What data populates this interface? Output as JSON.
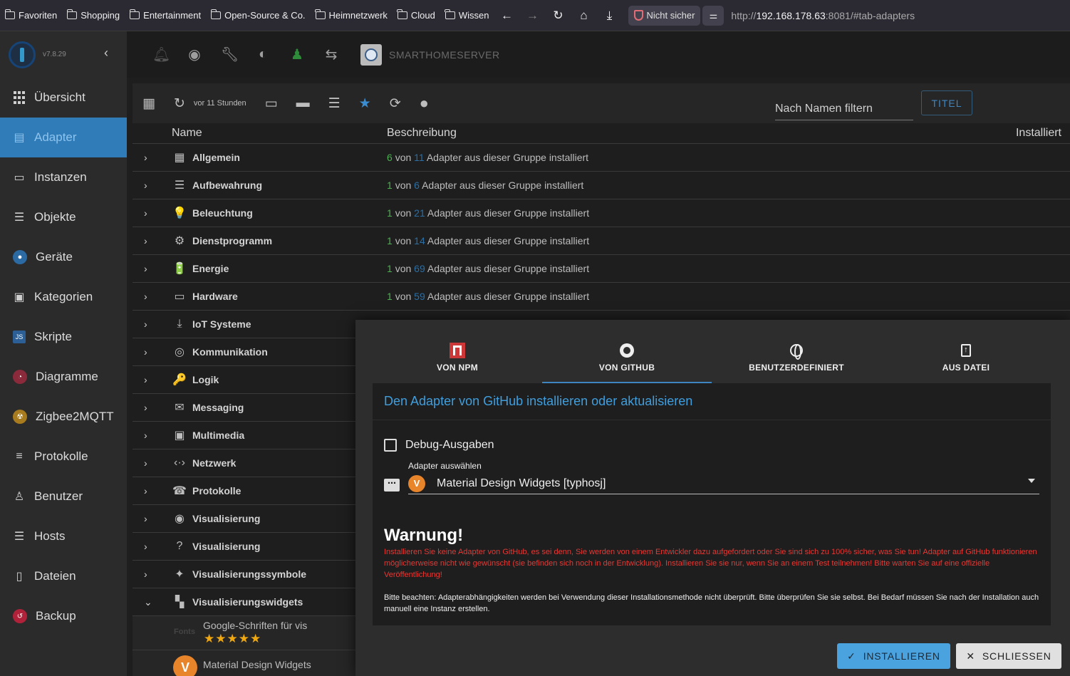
{
  "browser": {
    "bookmarks": [
      "Favoriten",
      "Shopping",
      "Entertainment",
      "Open-Source & Co.",
      "Heimnetzwerk",
      "Cloud",
      "Wissen"
    ],
    "security_label": "Nicht sicher",
    "url_prefix": "http://",
    "url_host": "192.168.178.63",
    "url_rest": ":8081/#tab-adapters"
  },
  "sidebar": {
    "version": "v7.8.29",
    "items": [
      {
        "label": "Übersicht",
        "icon": "grid-icon"
      },
      {
        "label": "Adapter",
        "icon": "store-icon",
        "active": true
      },
      {
        "label": "Instanzen",
        "icon": "instances-icon"
      },
      {
        "label": "Objekte",
        "icon": "list-icon"
      },
      {
        "label": "Geräte",
        "icon": "devices-icon"
      },
      {
        "label": "Kategorien",
        "icon": "categories-icon"
      },
      {
        "label": "Skripte",
        "icon": "js-icon"
      },
      {
        "label": "Diagramme",
        "icon": "chart-icon"
      },
      {
        "label": "Zigbee2MQTT",
        "icon": "zigbee-icon"
      },
      {
        "label": "Protokolle",
        "icon": "log-icon"
      },
      {
        "label": "Benutzer",
        "icon": "user-icon"
      },
      {
        "label": "Hosts",
        "icon": "hosts-icon"
      },
      {
        "label": "Dateien",
        "icon": "file-icon"
      },
      {
        "label": "Backup",
        "icon": "backup-icon"
      }
    ]
  },
  "topbar": {
    "server_name": "SMARTHOMESERVER"
  },
  "adapters": {
    "updated": "vor 11 Stunden",
    "filter_placeholder": "Nach Namen filtern",
    "titel_button": "TITEL",
    "col_name": "Name",
    "col_desc": "Beschreibung",
    "col_installed": "Installiert",
    "desc_von": "von",
    "desc_suffix": "Adapter aus dieser Gruppe installiert",
    "groups": [
      {
        "name": "Allgemein",
        "installed": "6",
        "total": "11",
        "icon": "▦"
      },
      {
        "name": "Aufbewahrung",
        "installed": "1",
        "total": "6",
        "icon": "☰"
      },
      {
        "name": "Beleuchtung",
        "installed": "1",
        "total": "21",
        "icon": "💡"
      },
      {
        "name": "Dienstprogramm",
        "installed": "1",
        "total": "14",
        "icon": "⚙"
      },
      {
        "name": "Energie",
        "installed": "1",
        "total": "69",
        "icon": "🔋"
      },
      {
        "name": "Hardware",
        "installed": "1",
        "total": "59",
        "icon": "▭"
      },
      {
        "name": "IoT Systeme",
        "icon": "⤓"
      },
      {
        "name": "Kommunikation",
        "icon": "◎"
      },
      {
        "name": "Logik",
        "icon": "🔑"
      },
      {
        "name": "Messaging",
        "icon": "✉"
      },
      {
        "name": "Multimedia",
        "icon": "▣"
      },
      {
        "name": "Netzwerk",
        "icon": "‹·›"
      },
      {
        "name": "Protokolle",
        "icon": "☎"
      },
      {
        "name": "Visualisierung",
        "icon": "◉"
      },
      {
        "name": "Visualisierung",
        "icon": "?"
      },
      {
        "name": "Visualisierungssymbole",
        "icon": "✦"
      },
      {
        "name": "Visualisierungswidgets",
        "icon": "▚",
        "expanded": true
      }
    ],
    "sub_items": [
      {
        "name": "Google-Schriften für vis",
        "stars": "★★★★★"
      },
      {
        "name": "Material Design Widgets"
      }
    ]
  },
  "dialog": {
    "tabs": [
      {
        "label": "VON NPM",
        "icon": "npm-icon"
      },
      {
        "label": "VON GITHUB",
        "icon": "github-icon",
        "active": true
      },
      {
        "label": "BENUTZERDEFINIERT",
        "icon": "globe-icon"
      },
      {
        "label": "AUS DATEI",
        "icon": "file-upload-icon"
      }
    ],
    "title": "Den Adapter von GitHub installieren oder aktualisieren",
    "debug_label": "Debug-Ausgaben",
    "select_label": "Adapter auswählen",
    "selected_adapter": "Material Design Widgets [typhosj]",
    "warning_title": "Warnung!",
    "warning_text": "Installieren Sie keine Adapter von GitHub, es sei denn, Sie werden von einem Entwickler dazu aufgefordert oder Sie sind sich zu 100% sicher, was Sie tun! Adapter auf GitHub funktionieren möglicherweise nicht wie gewünscht (sie befinden sich noch in der Entwicklung). Installieren Sie sie nur, wenn Sie an einem Test teilnehmen! Bitte warten Sie auf eine offizielle Veröffentlichung!",
    "note_text": "Bitte beachten: Adapterabhängigkeiten werden bei Verwendung dieser Installationsmethode nicht überprüft. Bitte überprüfen Sie sie selbst. Bei Bedarf müssen Sie nach der Installation auch manuell eine Instanz erstellen.",
    "install_button": "INSTALLIEREN",
    "close_button": "SCHLIESSEN"
  },
  "colors": {
    "accent": "#2f7cb8",
    "link": "#3f9ede",
    "warning": "#e53935",
    "installed_count": "#4caf50",
    "total_count": "#2b6ea3"
  }
}
